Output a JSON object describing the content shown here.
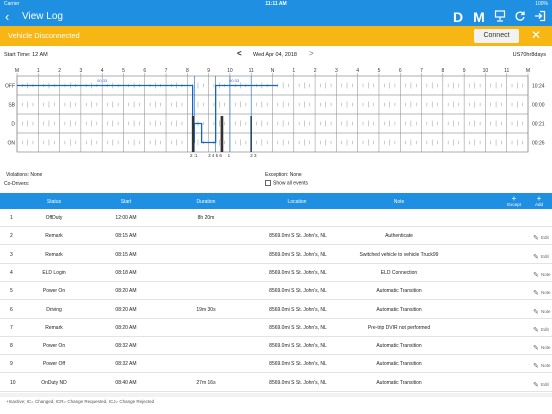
{
  "status_bar": {
    "carrier": "Carrier",
    "time": "11:11 AM",
    "battery": "100%"
  },
  "nav": {
    "back_glyph": "‹",
    "title": "View Log",
    "d_label": "D",
    "m_label": "M"
  },
  "banner": {
    "text": "Vehicle Disconnected",
    "connect_label": "Connect",
    "close_glyph": "✕"
  },
  "date_row": {
    "start_time": "Start Time: 12 AM",
    "prev_glyph": "<",
    "date": "Wed Apr 04, 2018",
    "next_glyph": ">",
    "cycle": "US70hr8days"
  },
  "graph": {
    "hour_labels": [
      "M",
      "1",
      "2",
      "3",
      "4",
      "5",
      "6",
      "7",
      "8",
      "9",
      "10",
      "11",
      "N",
      "1",
      "2",
      "3",
      "4",
      "5",
      "6",
      "7",
      "8",
      "9",
      "10",
      "11",
      "M"
    ],
    "status_labels": [
      "OFF",
      "SB",
      "D",
      "ON"
    ],
    "totals": [
      "10:24",
      "00:00",
      "00:21",
      "00:26"
    ],
    "duty_segments": [
      {
        "status": 0,
        "start": 0,
        "end": 8.25
      },
      {
        "status": 3,
        "start": 8.25,
        "end": 8.33
      },
      {
        "status": 2,
        "start": 8.33,
        "end": 8.67
      },
      {
        "status": 3,
        "start": 8.67,
        "end": 9.33
      },
      {
        "status": 0,
        "start": 9.33,
        "end": 12.25
      }
    ],
    "event_labels": [
      "00:33",
      "00:33"
    ],
    "marker_labels": [
      "2 :1",
      "3 4 5 6",
      "1",
      "2 3"
    ]
  },
  "info": {
    "violations": "Violations:  None",
    "exception": "Exception:  None",
    "co_drivers": "Co-Drivers:",
    "show_all": "Show all events"
  },
  "table": {
    "headers": [
      "Status",
      "Start",
      "Duration",
      "Location",
      "Note"
    ],
    "except_label": "Except",
    "add_label": "Add",
    "rows": [
      {
        "num": "1",
        "status": "OffDuty",
        "start": "12:00 AM",
        "duration": "8h 20m",
        "location": "",
        "note": "",
        "action": ""
      },
      {
        "num": "2",
        "status": "Remark",
        "start": "08:15 AM",
        "duration": "",
        "location": "8569.0mi S St. John's, NL",
        "note": "Authenticate",
        "action": "Edit"
      },
      {
        "num": "3",
        "status": "Remark",
        "start": "08:15 AM",
        "duration": "",
        "location": "8569.0mi S St. John's, NL",
        "note": "Switched vehicle  to vehicle Truck99",
        "action": "Edit"
      },
      {
        "num": "4",
        "status": "ELD Login",
        "start": "08:18 AM",
        "duration": "",
        "location": "8569.0mi S St. John's, NL",
        "note": "ELD Connection",
        "action": "Note"
      },
      {
        "num": "5",
        "status": "Power On",
        "start": "08:20 AM",
        "duration": "",
        "location": "8569.0mi S St. John's, NL",
        "note": "Automatic Transition",
        "action": "Note"
      },
      {
        "num": "6",
        "status": "Driving",
        "start": "08:20 AM",
        "duration": "19m 30s",
        "location": "8569.0mi S St. John's, NL",
        "note": "Automatic Transition",
        "action": "Note"
      },
      {
        "num": "7",
        "status": "Remark",
        "start": "08:20 AM",
        "duration": "",
        "location": "8569.0mi S St. John's, NL",
        "note": "Pre-trip DVIR not performed",
        "action": "Edit"
      },
      {
        "num": "8",
        "status": "Power On",
        "start": "08:32 AM",
        "duration": "",
        "location": "8569.0mi S St. John's, NL",
        "note": "Automatic Transition",
        "action": "Note"
      },
      {
        "num": "9",
        "status": "Power Off",
        "start": "08:32 AM",
        "duration": "",
        "location": "8569.0mi S St. John's, NL",
        "note": "Automatic Transition",
        "action": "Note"
      },
      {
        "num": "10",
        "status": "OnDuty ND",
        "start": "08:40 AM",
        "duration": "27m 16s",
        "location": "8569.0mi S St. John's, NL",
        "note": "Automatic Transition",
        "action": "Edit"
      }
    ]
  },
  "footer": "+Inactive; IC= Changed, ICR= Change Requested, ICJ= Change Rejected",
  "colors": {
    "primary": "#1e8fe1",
    "banner": "#f7b614",
    "duty_line": "#1565c0"
  }
}
